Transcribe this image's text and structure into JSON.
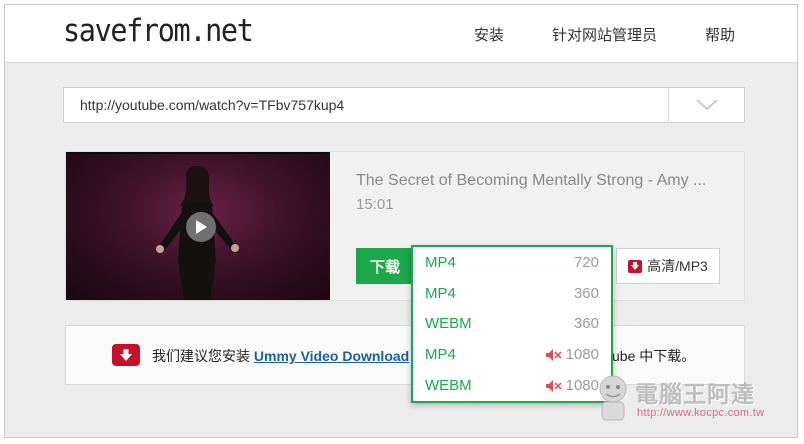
{
  "header": {
    "logo": "savefrom.net",
    "nav": [
      "安装",
      "针对网站管理员",
      "帮助"
    ]
  },
  "search": {
    "url_value": "http://youtube.com/watch?v=TFbv757kup4"
  },
  "video": {
    "title": "The Secret of Becoming Mentally Strong - Amy ...",
    "duration": "15:01",
    "download_label": "下载",
    "hq_label": "高清/MP3"
  },
  "formats": [
    {
      "format": "MP4",
      "quality": "720",
      "muted": false
    },
    {
      "format": "MP4",
      "quality": "360",
      "muted": false
    },
    {
      "format": "WEBM",
      "quality": "360",
      "muted": false
    },
    {
      "format": "MP4",
      "quality": "1080",
      "muted": true
    },
    {
      "format": "WEBM",
      "quality": "1080",
      "muted": true
    }
  ],
  "recommendation": {
    "prefix": "我们建议您安装",
    "link": "Ummy Video Download",
    "suffix": "ube 中下载。"
  },
  "watermark": {
    "title": "電腦王阿達",
    "url": "http://www.kocpc.com.tw"
  },
  "colors": {
    "accent_green": "#1aa84a",
    "alert_red": "#c4122b",
    "link_blue": "#1c5f9e"
  }
}
